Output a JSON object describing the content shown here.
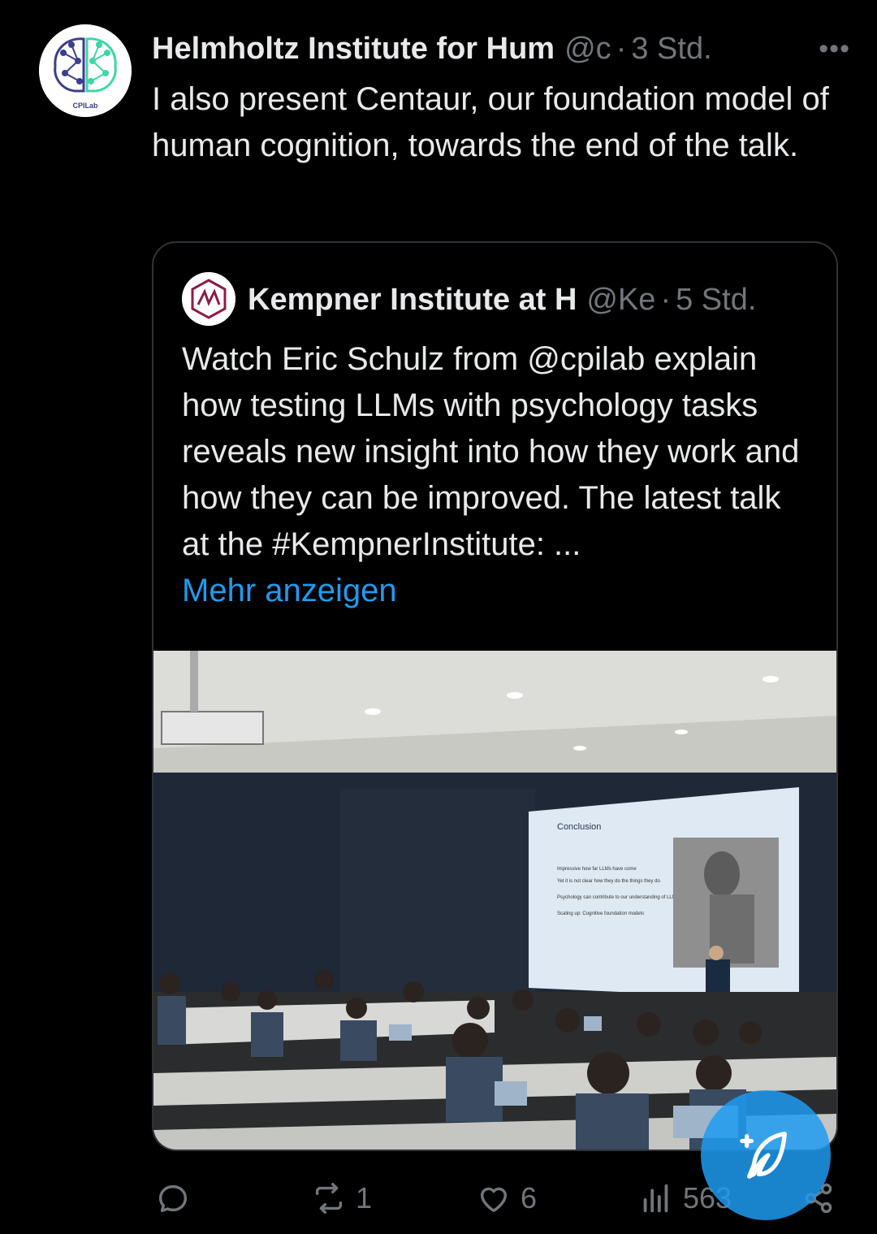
{
  "tweet": {
    "author_name": "Helmholtz Institute for Hum",
    "author_handle": "@c",
    "separator": "·",
    "time": "3 Std.",
    "more": "•••",
    "avatar_label": "CPILab",
    "text": "I also present Centaur, our foundation model of human cognition, towards the end of the talk."
  },
  "quote": {
    "author_name": "Kempner Institute at H",
    "author_handle": "@Ke",
    "separator": "·",
    "time": "5 Std.",
    "text": "Watch Eric Schulz from @cpilab explain how testing LLMs with psychology tasks reveals new insight into how they work and how they can be improved. The latest talk at the #KempnerInstitute: ...",
    "show_more": "Mehr anzeigen",
    "media": {
      "slide_title": "Conclusion",
      "slide_bullets": [
        "Impressive how far LLMs have come",
        "Yet it is not clear how they do the things they do",
        "Psychology can contribute to our understanding of LLMs",
        "Scaling up: Cognitive foundation models"
      ]
    }
  },
  "actions": {
    "reply_count": "",
    "repost_count": "1",
    "like_count": "6",
    "views_count": "563"
  },
  "colors": {
    "background": "#000000",
    "text": "#e7e9ea",
    "secondary": "#71767b",
    "link": "#1d9bf0",
    "border": "#2f3336"
  }
}
